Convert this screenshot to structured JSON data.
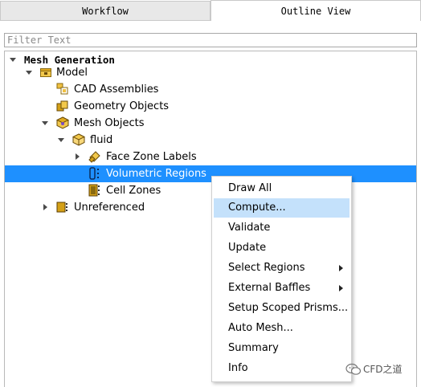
{
  "tabs": [
    {
      "label": "Workflow",
      "active": false
    },
    {
      "label": "Outline View",
      "active": true
    }
  ],
  "filter": {
    "placeholder": "Filter Text",
    "value": ""
  },
  "tree": {
    "rows": [
      {
        "label": "Mesh Generation",
        "expanded": true,
        "icon": "none",
        "selected": false
      },
      {
        "label": "Model",
        "expanded": true,
        "icon": "model-icon",
        "selected": false
      },
      {
        "label": "CAD Assemblies",
        "icon": "cad-assemblies-icon",
        "selected": false
      },
      {
        "label": "Geometry Objects",
        "icon": "geometry-objects-icon",
        "selected": false
      },
      {
        "label": "Mesh Objects",
        "expanded": true,
        "icon": "mesh-objects-icon",
        "selected": false
      },
      {
        "label": "fluid",
        "expanded": true,
        "icon": "fluid-box-icon",
        "selected": false
      },
      {
        "label": "Face Zone Labels",
        "expanded": false,
        "icon": "face-zone-labels-icon",
        "selected": false
      },
      {
        "label": "Volumetric Regions",
        "icon": "volumetric-regions-icon",
        "selected": true
      },
      {
        "label": "Cell Zones",
        "icon": "cell-zones-icon",
        "selected": false
      },
      {
        "label": "Unreferenced",
        "expanded": false,
        "icon": "unreferenced-icon",
        "selected": false
      }
    ]
  },
  "context_menu": {
    "items": [
      {
        "label": "Draw All",
        "submenu": false,
        "hover": false
      },
      {
        "label": "Compute...",
        "submenu": false,
        "hover": true
      },
      {
        "label": "Validate",
        "submenu": false,
        "hover": false
      },
      {
        "label": "Update",
        "submenu": false,
        "hover": false
      },
      {
        "label": "Select Regions",
        "submenu": true,
        "hover": false
      },
      {
        "label": "External Baffles",
        "submenu": true,
        "hover": false
      },
      {
        "label": "Setup Scoped Prisms...",
        "submenu": false,
        "hover": false
      },
      {
        "label": "Auto Mesh...",
        "submenu": false,
        "hover": false
      },
      {
        "label": "Summary",
        "submenu": false,
        "hover": false
      },
      {
        "label": "Info",
        "submenu": false,
        "hover": false
      }
    ]
  },
  "watermark": {
    "text": "CFD之道",
    "icon": "wechat-icon"
  },
  "colors": {
    "selection": "#1e90ff",
    "menu_hover": "#c4e1fb",
    "icon_gold": "#d4a017"
  }
}
